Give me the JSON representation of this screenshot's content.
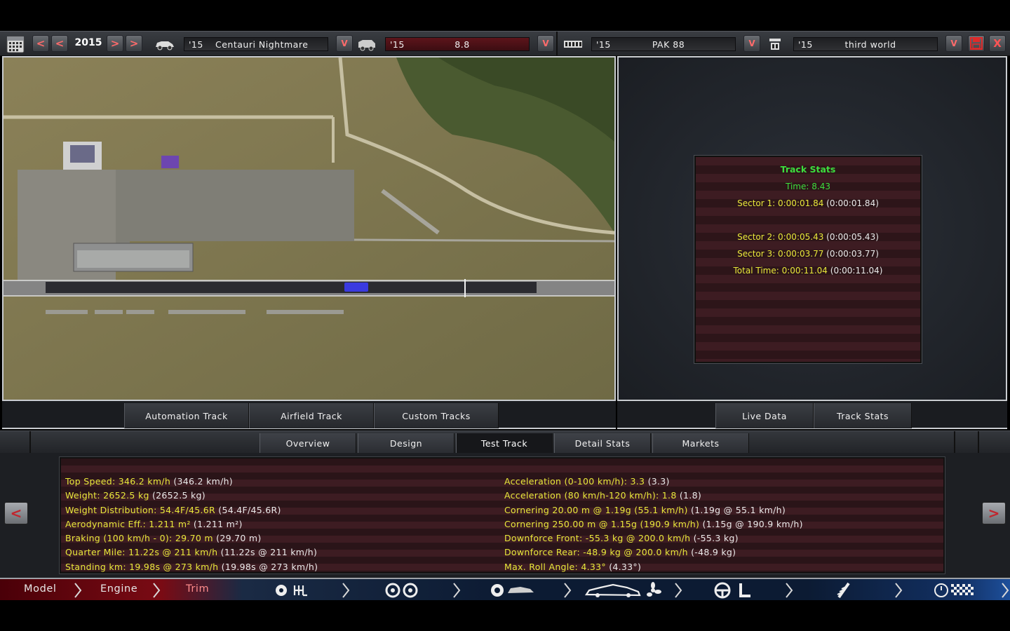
{
  "toolbar": {
    "year": "2015",
    "car": {
      "year": "'15",
      "name": "Centauri Nightmare"
    },
    "trim": {
      "year": "'15",
      "name": "8.8"
    },
    "engine": {
      "year": "'15",
      "name": "PAK 88"
    },
    "variant": {
      "year": "'15",
      "name": "third world"
    },
    "prev_glyph": "<",
    "next_glyph": ">",
    "dropdown_glyph": "V",
    "close_glyph": "X"
  },
  "map_tabs": [
    "Automation Track",
    "Airfield Track",
    "Custom Tracks"
  ],
  "right_tabs": [
    "Live Data",
    "Track Stats"
  ],
  "track_stats": {
    "title": "Track Stats",
    "time": "Time: 8.43",
    "sectors": [
      {
        "label": "Sector 1: 0:00:01.84",
        "paren": "(0:00:01.84)"
      },
      {
        "label": "Sector 2: 0:00:05.43",
        "paren": "(0:00:05.43)"
      },
      {
        "label": "Sector 3: 0:00:03.77",
        "paren": "(0:00:03.77)"
      },
      {
        "label": "Total Time: 0:00:11.04",
        "paren": "(0:00:11.04)"
      }
    ]
  },
  "main_tabs": [
    {
      "label": "Overview",
      "active": false
    },
    {
      "label": "Design",
      "active": false
    },
    {
      "label": "Test Track",
      "active": true
    },
    {
      "label": "Detail Stats",
      "active": false
    },
    {
      "label": "Markets",
      "active": false
    }
  ],
  "stats_left": [
    {
      "label": "Top Speed: 346.2 km/h",
      "paren": "(346.2 km/h)"
    },
    {
      "label": "Weight: 2652.5 kg",
      "paren": "(2652.5 kg)"
    },
    {
      "label": "Weight Distribution: 54.4F/45.6R",
      "paren": "(54.4F/45.6R)"
    },
    {
      "label": "Aerodynamic Eff.: 1.211 m²",
      "paren": "(1.211 m²)"
    },
    {
      "label": "Braking (100 km/h - 0): 29.70 m",
      "paren": "(29.70 m)"
    },
    {
      "label": "Quarter Mile: 11.22s @ 211 km/h",
      "paren": "(11.22s @ 211 km/h)"
    },
    {
      "label": "Standing km: 19.98s @ 273 km/h",
      "paren": "(19.98s @ 273 km/h)"
    }
  ],
  "stats_right": [
    {
      "label": "Acceleration (0-100 km/h): 3.3",
      "paren": "(3.3)"
    },
    {
      "label": "Acceleration (80 km/h-120 km/h): 1.8",
      "paren": "(1.8)"
    },
    {
      "label": "Cornering 20.00 m @ 1.19g (55.1 km/h)",
      "paren": "(1.19g @ 55.1 km/h)"
    },
    {
      "label": "Cornering 250.00 m @ 1.15g (190.9 km/h)",
      "paren": "(1.15g @ 190.9 km/h)"
    },
    {
      "label": "Downforce Front: -55.3 kg @ 200.0 km/h",
      "paren": "(-55.3 kg)"
    },
    {
      "label": "Downforce Rear: -48.9 kg @ 200.0 km/h",
      "paren": "(-48.9 kg)"
    },
    {
      "label": "Max. Roll Angle: 4.33°",
      "paren": "(4.33°)"
    }
  ],
  "bottom_nav": {
    "model": "Model",
    "engine": "Engine",
    "trim": "Trim",
    "icons": [
      "gearbox-icon",
      "wheels-icon",
      "body-icon",
      "aero-icon",
      "interior-icon",
      "suspension-icon",
      "test-track-icon"
    ]
  },
  "colors": {
    "stat_label": "#e8e83a",
    "stat_value": "#eaeaea",
    "track_title": "#3dde3d",
    "accent_red": "#c0262e"
  }
}
